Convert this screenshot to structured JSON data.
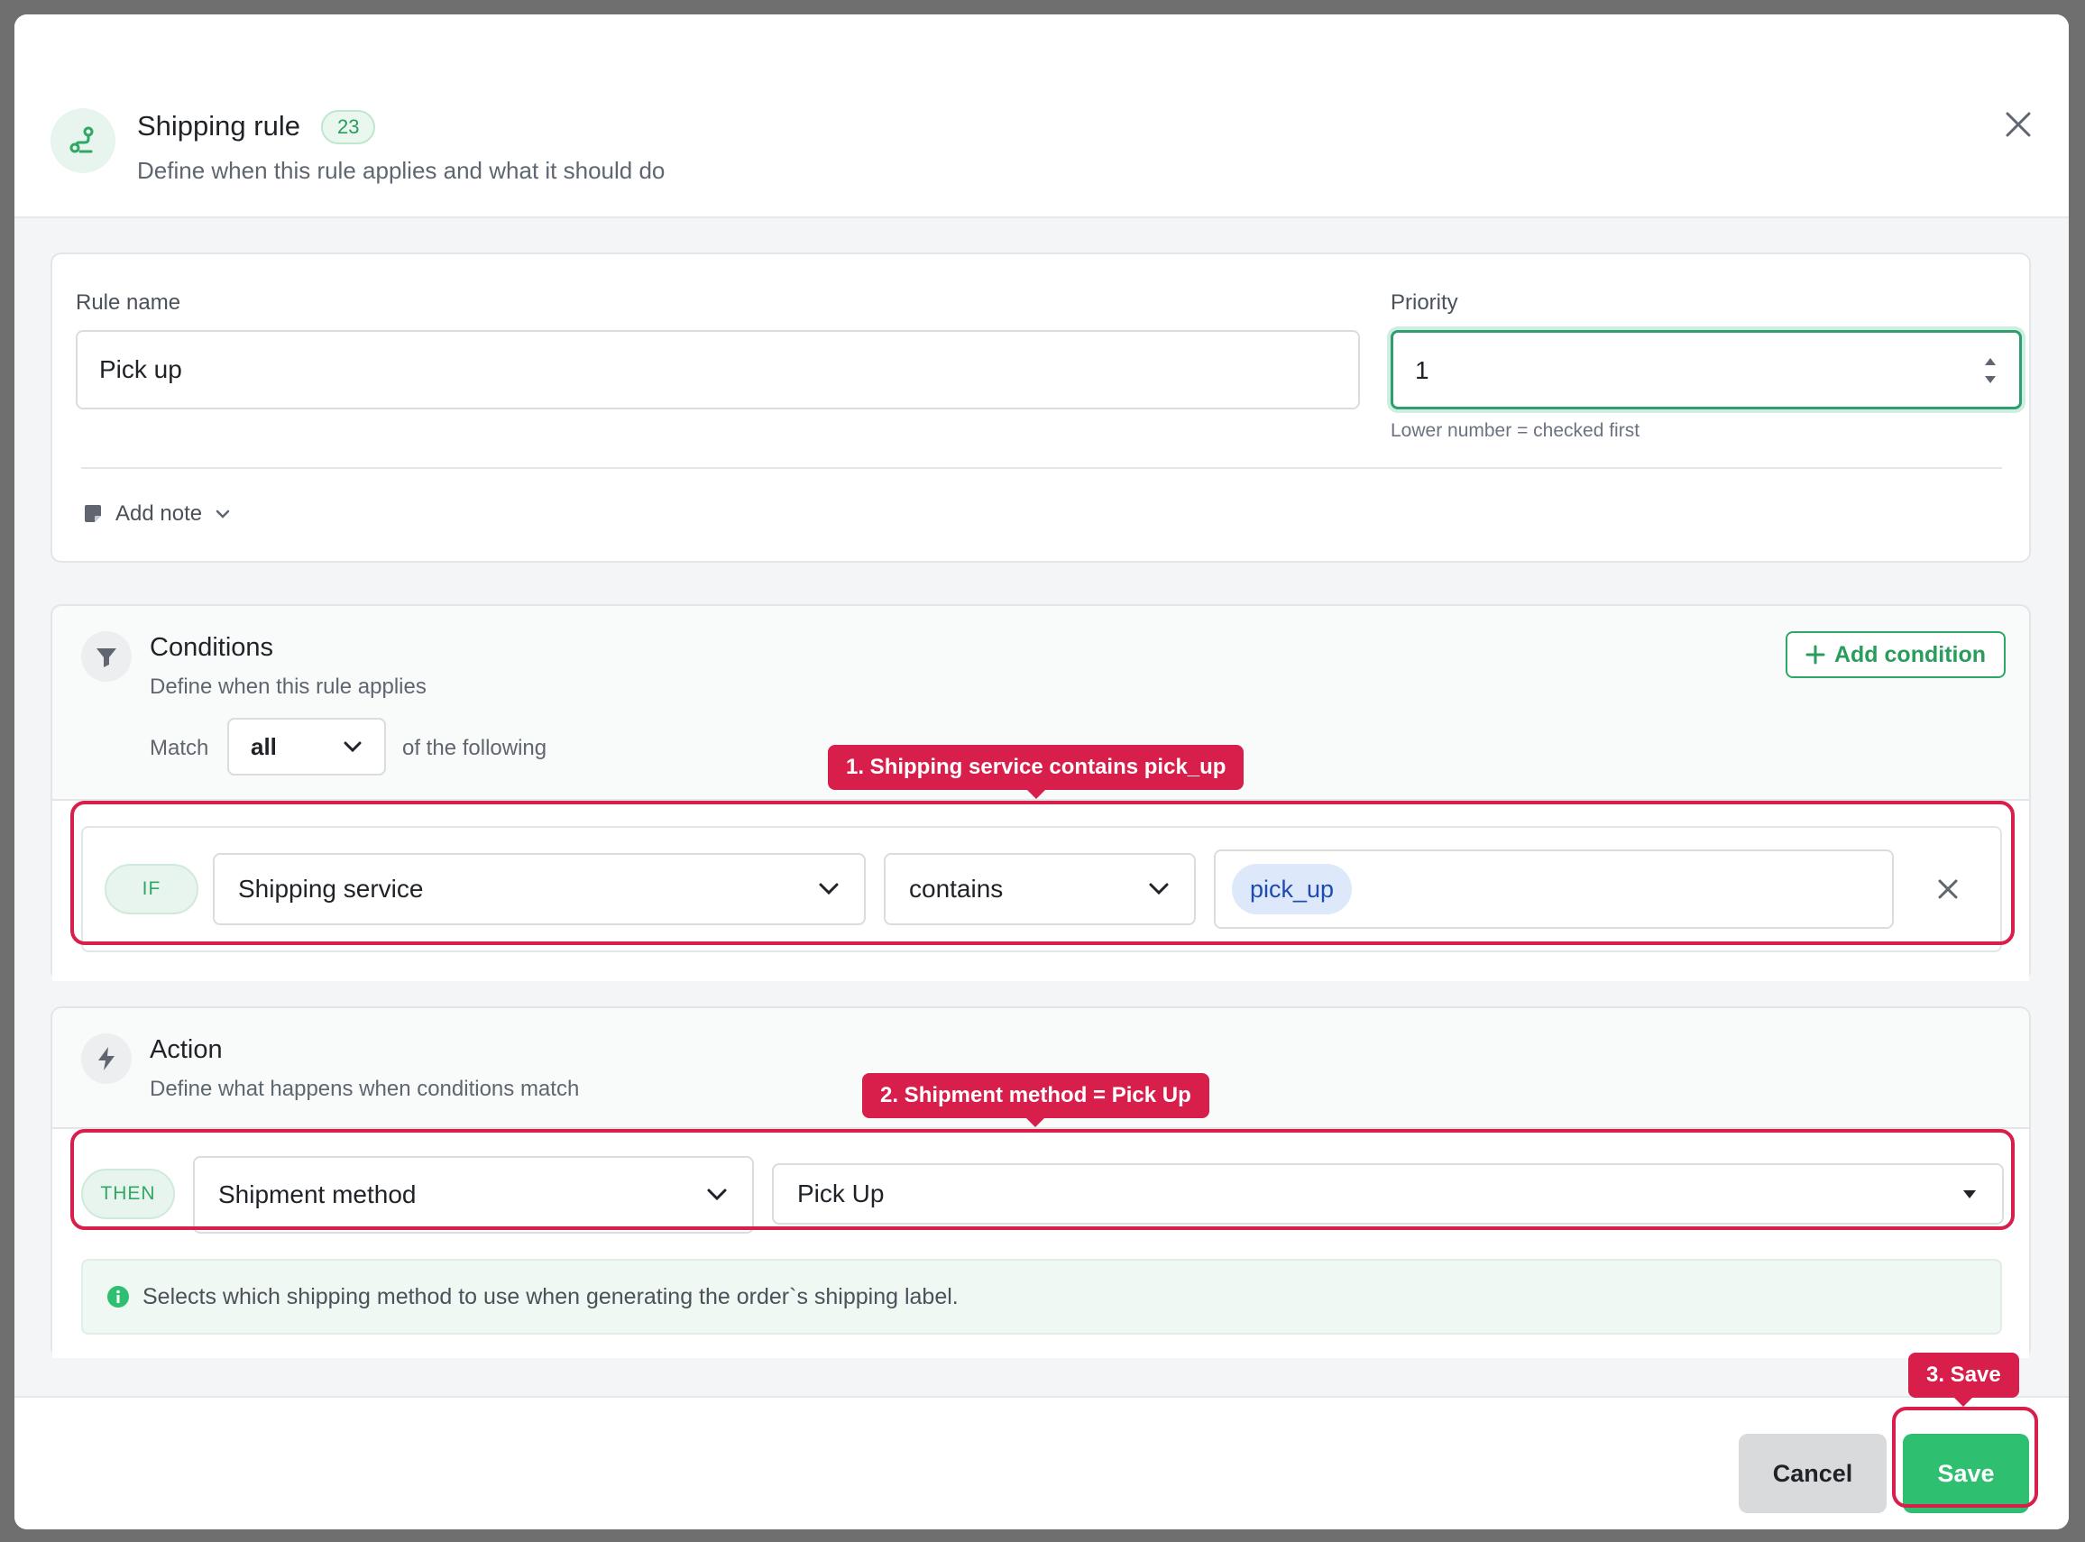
{
  "header": {
    "title": "Shipping rule",
    "badge": "23",
    "subtitle": "Define when this rule applies and what it should do"
  },
  "rule_form": {
    "name_label": "Rule name",
    "name_value": "Pick up",
    "priority_label": "Priority",
    "priority_value": "1",
    "priority_hint": "Lower number = checked first",
    "add_note_label": "Add note"
  },
  "conditions": {
    "title": "Conditions",
    "subtitle": "Define when this rule applies",
    "add_button": "Add condition",
    "match_label": "Match",
    "match_value": "all",
    "match_suffix": "of the following",
    "rows": [
      {
        "prefix": "IF",
        "field": "Shipping service",
        "operator": "contains",
        "value_tag": "pick_up"
      }
    ]
  },
  "action": {
    "title": "Action",
    "subtitle": "Define what happens when conditions match",
    "prefix": "THEN",
    "field": "Shipment method",
    "value": "Pick Up",
    "info": "Selects which shipping method to use when generating the order`s shipping label."
  },
  "footer": {
    "cancel": "Cancel",
    "save": "Save"
  },
  "annotations": {
    "step1": "1. Shipping service contains pick_up",
    "step2": "2. Shipment method = Pick Up",
    "step3": "3. Save"
  },
  "colors": {
    "accent_green": "#2fbf71",
    "annotation_red": "#d81e4a",
    "tag_blue": "#dde8fb"
  }
}
